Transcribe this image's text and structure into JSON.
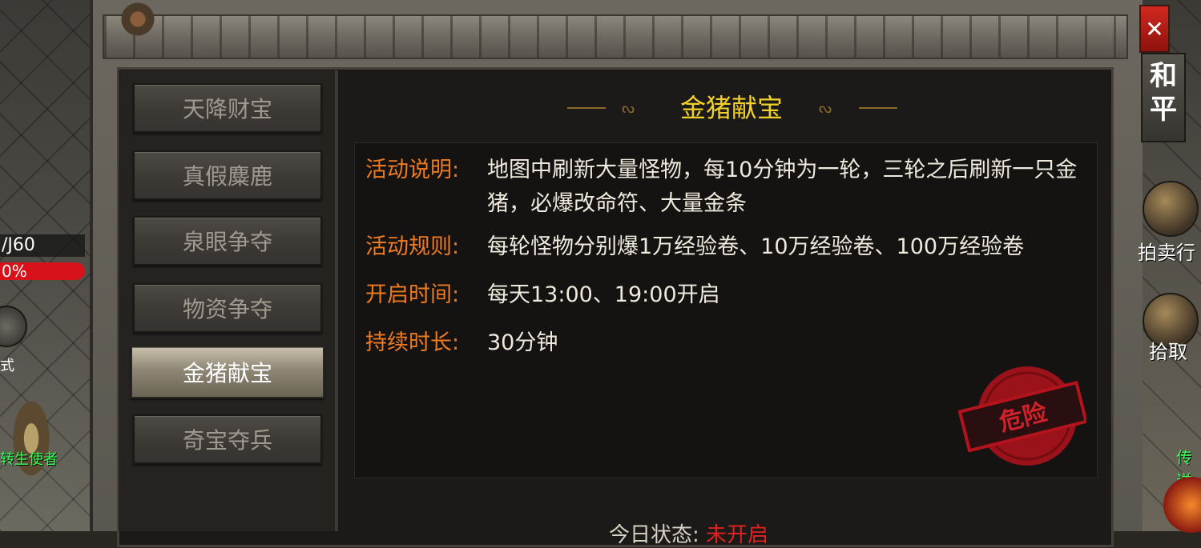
{
  "hud": {
    "level_text": "/J60",
    "hp_text": "0%",
    "left_icon_label": "式",
    "left_npc_name": "转生使者"
  },
  "dialog": {
    "title": "金猪献宝",
    "close_label": "✕",
    "menu": [
      {
        "label": "天降财宝",
        "active": false
      },
      {
        "label": "真假麋鹿",
        "active": false
      },
      {
        "label": "泉眼争夺",
        "active": false
      },
      {
        "label": "物资争夺",
        "active": false
      },
      {
        "label": "金猪献宝",
        "active": true
      },
      {
        "label": "奇宝夺兵",
        "active": false
      }
    ],
    "info": [
      {
        "label": "活动说明:",
        "value": "地图中刷新大量怪物，每10分钟为一轮，三轮之后刷新一只金猪，必爆改命符、大量金条"
      },
      {
        "label": "活动规则:",
        "value": "每轮怪物分别爆1万经验卷、10万经验卷、100万经验卷"
      },
      {
        "label": "开启时间:",
        "value": "每天13:00、19:00开启"
      },
      {
        "label": "持续时长:",
        "value": "30分钟"
      }
    ],
    "stamp_text": "危险",
    "bottom_status_prefix": "今日状态:",
    "bottom_status_value": "未开启"
  },
  "side": {
    "mode_tab": "和平",
    "auction_label": "拍卖行",
    "pickup_label": "拾取",
    "npc_label": "传送"
  },
  "colors": {
    "title_gold": "#f2d22a",
    "label_orange": "#f07a1e",
    "value_text": "#efe9de",
    "stamp_red": "#b3131c"
  }
}
